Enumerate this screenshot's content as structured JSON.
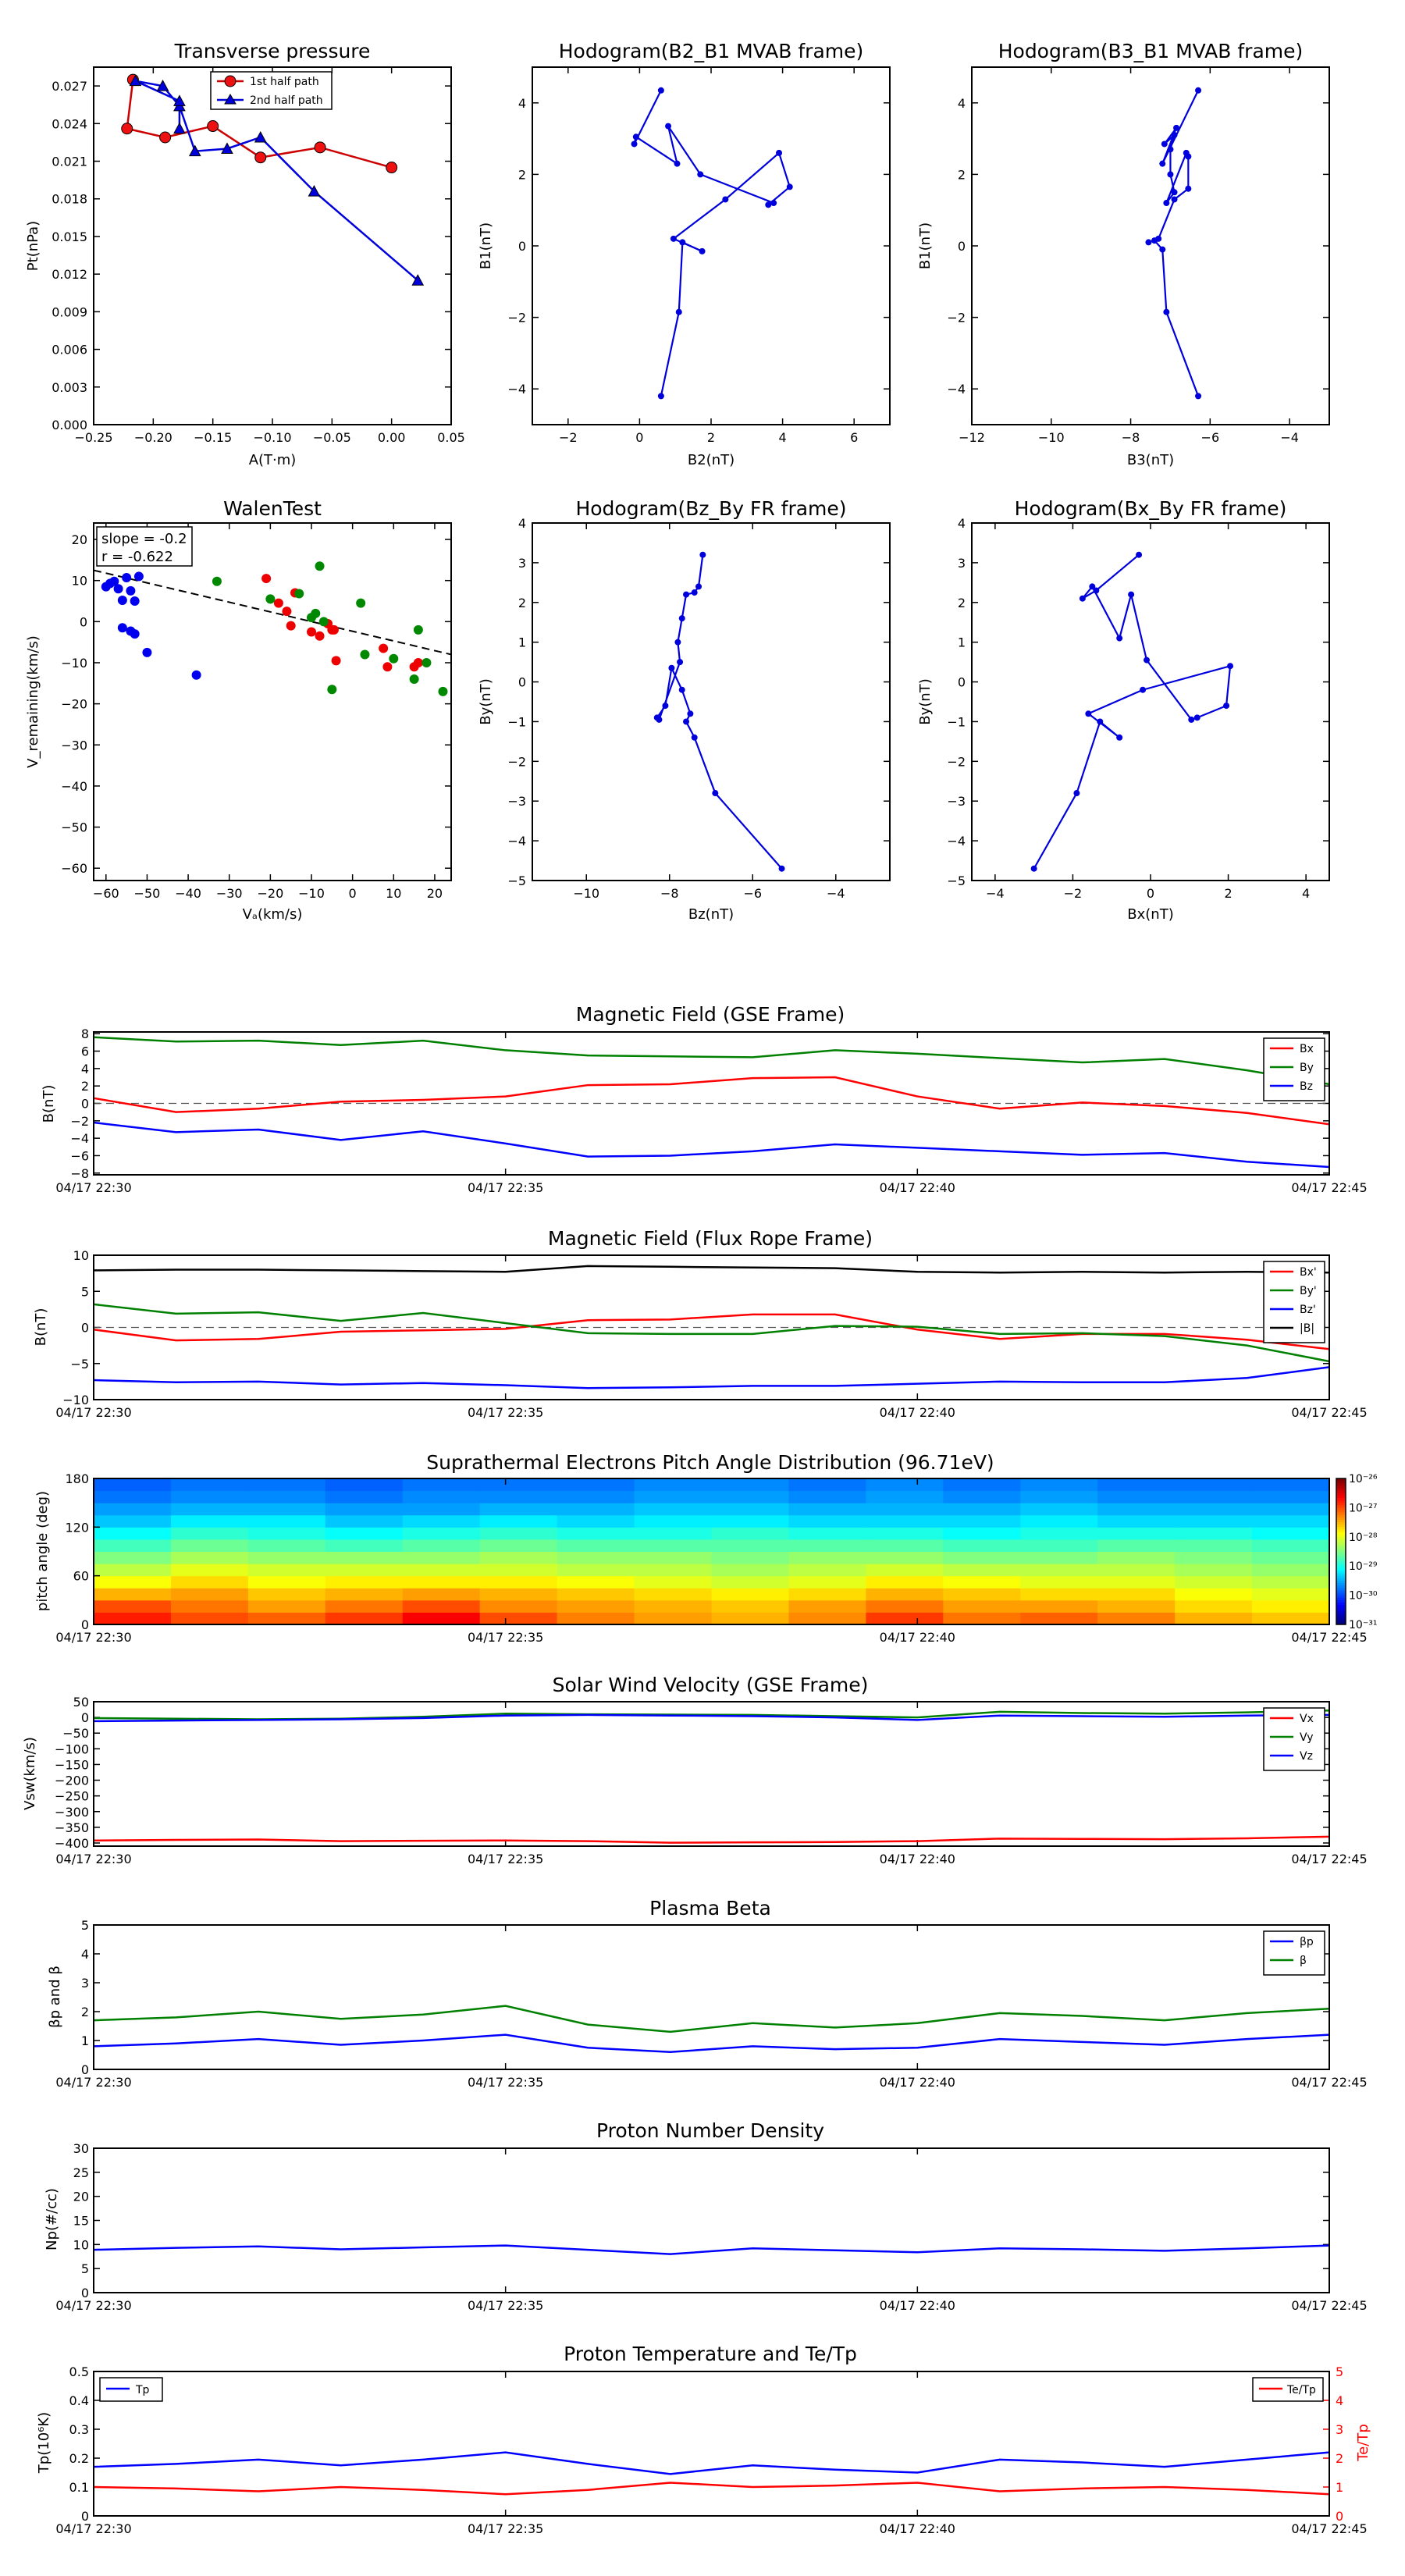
{
  "tp": {
    "title": "Transverse pressure",
    "xlabel": "A(T·m)",
    "ylabel": "Pt(nPa)",
    "xticks": [
      "−0.25",
      "−0.20",
      "−0.15",
      "−0.10",
      "−0.05",
      "0.00",
      "0.05"
    ],
    "yticks": [
      "0.000",
      "0.003",
      "0.006",
      "0.009",
      "0.012",
      "0.015",
      "0.018",
      "0.021",
      "0.024",
      "0.027"
    ],
    "legend": [
      "1st half path",
      "2nd half path"
    ],
    "xlim": [
      -0.25,
      0.05
    ],
    "ylim": [
      0.0,
      0.0285
    ],
    "s1": [
      [
        0.0,
        0.0205
      ],
      [
        -0.06,
        0.0221
      ],
      [
        -0.11,
        0.0213
      ],
      [
        -0.15,
        0.0238
      ],
      [
        -0.19,
        0.0229
      ],
      [
        -0.222,
        0.0236
      ],
      [
        -0.217,
        0.0275
      ]
    ],
    "s2": [
      [
        0.022,
        0.0115
      ],
      [
        -0.065,
        0.0186
      ],
      [
        -0.11,
        0.0229
      ],
      [
        -0.138,
        0.022
      ],
      [
        -0.165,
        0.0218
      ],
      [
        -0.178,
        0.0254
      ],
      [
        -0.192,
        0.027
      ],
      [
        -0.215,
        0.0274
      ],
      [
        -0.178,
        0.0258
      ],
      [
        -0.178,
        0.0236
      ]
    ]
  },
  "h1": {
    "title": "Hodogram(B2_B1 MVAB frame)",
    "xlabel": "B2(nT)",
    "ylabel": "B1(nT)",
    "xticks": [
      "−2",
      "0",
      "2",
      "4",
      "6"
    ],
    "yticks": [
      "−4",
      "−2",
      "0",
      "2",
      "4"
    ],
    "xlim": [
      -3,
      7
    ],
    "ylim": [
      -5,
      5
    ],
    "pts": [
      [
        0.6,
        -4.2
      ],
      [
        1.1,
        -1.85
      ],
      [
        1.2,
        0.1
      ],
      [
        1.75,
        -0.15
      ],
      [
        0.95,
        0.2
      ],
      [
        2.4,
        1.3
      ],
      [
        3.9,
        2.6
      ],
      [
        4.2,
        1.65
      ],
      [
        3.6,
        1.15
      ],
      [
        3.75,
        1.2
      ],
      [
        1.7,
        2.0
      ],
      [
        0.8,
        3.35
      ],
      [
        1.05,
        2.3
      ],
      [
        -0.1,
        3.05
      ],
      [
        -0.15,
        2.85
      ],
      [
        0.6,
        4.35
      ]
    ]
  },
  "h2": {
    "title": "Hodogram(B3_B1 MVAB frame)",
    "xlabel": "B3(nT)",
    "ylabel": "B1(nT)",
    "xticks": [
      "−12",
      "−10",
      "−8",
      "−6",
      "−4"
    ],
    "yticks": [
      "−4",
      "−2",
      "0",
      "2",
      "4"
    ],
    "xlim": [
      -12,
      -3
    ],
    "ylim": [
      -5,
      5
    ],
    "pts": [
      [
        -6.3,
        -4.2
      ],
      [
        -7.1,
        -1.85
      ],
      [
        -7.2,
        -0.1
      ],
      [
        -7.4,
        0.15
      ],
      [
        -7.55,
        0.1
      ],
      [
        -7.3,
        0.2
      ],
      [
        -6.9,
        1.3
      ],
      [
        -6.55,
        1.6
      ],
      [
        -6.55,
        2.5
      ],
      [
        -6.6,
        2.6
      ],
      [
        -7.1,
        1.2
      ],
      [
        -6.9,
        1.5
      ],
      [
        -7.0,
        2.0
      ],
      [
        -7.0,
        2.7
      ],
      [
        -6.9,
        3.1
      ],
      [
        -7.15,
        2.85
      ],
      [
        -6.85,
        3.3
      ],
      [
        -7.2,
        2.3
      ],
      [
        -6.3,
        4.35
      ]
    ]
  },
  "wt": {
    "title": "WalenTest",
    "xlabel": "Vₐ(km/s)",
    "ylabel": "V_remaining(km/s)",
    "xticks": [
      "−60",
      "−50",
      "−40",
      "−30",
      "−20",
      "−10",
      "0",
      "10",
      "20"
    ],
    "yticks": [
      "−60",
      "−50",
      "−40",
      "−30",
      "−20",
      "−10",
      "0",
      "10",
      "20"
    ],
    "slope_text": "slope = -0.2",
    "r_text": "r = -0.622",
    "xlim": [
      -63,
      24
    ],
    "ylim": [
      -63,
      24
    ],
    "line": [
      [
        -63,
        12.5
      ],
      [
        24,
        -8
      ]
    ],
    "blue": [
      [
        -60,
        8.5
      ],
      [
        -59,
        9.3
      ],
      [
        -58,
        9.8
      ],
      [
        -57,
        8
      ],
      [
        -56,
        5.2
      ],
      [
        -55,
        10.7
      ],
      [
        -54,
        7.5
      ],
      [
        -53,
        5
      ],
      [
        -52,
        11
      ],
      [
        -56,
        -1.5
      ],
      [
        -54,
        -2.3
      ],
      [
        -53,
        -3
      ],
      [
        -50,
        -7.5
      ],
      [
        -38,
        -13
      ]
    ],
    "red": [
      [
        -21,
        10.5
      ],
      [
        -18,
        4.5
      ],
      [
        -16,
        2.5
      ],
      [
        -14,
        7
      ],
      [
        -15,
        -1
      ],
      [
        -10,
        -2.5
      ],
      [
        -8,
        -3.5
      ],
      [
        -6,
        -0.5
      ],
      [
        -5,
        -2
      ],
      [
        -4.5,
        -2
      ],
      [
        -4,
        -9.5
      ],
      [
        7.5,
        -6.5
      ],
      [
        8.5,
        -11
      ],
      [
        15,
        -11
      ],
      [
        16,
        -10
      ]
    ],
    "green": [
      [
        -33,
        9.8
      ],
      [
        -20,
        5.5
      ],
      [
        -13,
        6.8
      ],
      [
        -10,
        1
      ],
      [
        -9,
        2
      ],
      [
        -8,
        13.5
      ],
      [
        -7,
        0
      ],
      [
        -5,
        -16.5
      ],
      [
        2,
        4.5
      ],
      [
        3,
        -8
      ],
      [
        10,
        -9
      ],
      [
        15,
        -14
      ],
      [
        16,
        -2
      ],
      [
        18,
        -10
      ],
      [
        22,
        -17
      ]
    ]
  },
  "h3": {
    "title": "Hodogram(Bz_By FR frame)",
    "xlabel": "Bz(nT)",
    "ylabel": "By(nT)",
    "xticks": [
      "−10",
      "−8",
      "−6",
      "−4"
    ],
    "yticks": [
      "−5",
      "−4",
      "−3",
      "−2",
      "−1",
      "0",
      "1",
      "2",
      "3",
      "4"
    ],
    "xlim": [
      -11.3,
      -2.7
    ],
    "ylim": [
      -5,
      4
    ],
    "pts": [
      [
        -5.3,
        -4.7
      ],
      [
        -6.9,
        -2.8
      ],
      [
        -7.4,
        -1.4
      ],
      [
        -7.6,
        -1.0
      ],
      [
        -7.5,
        -0.8
      ],
      [
        -7.7,
        -0.2
      ],
      [
        -7.95,
        0.35
      ],
      [
        -8.1,
        -0.6
      ],
      [
        -8.3,
        -0.9
      ],
      [
        -8.25,
        -0.95
      ],
      [
        -7.75,
        0.5
      ],
      [
        -7.8,
        1.0
      ],
      [
        -7.7,
        1.6
      ],
      [
        -7.6,
        2.2
      ],
      [
        -7.4,
        2.25
      ],
      [
        -7.3,
        2.4
      ],
      [
        -7.2,
        3.2
      ]
    ]
  },
  "h4": {
    "title": "Hodogram(Bx_By FR frame)",
    "xlabel": "Bx(nT)",
    "ylabel": "By(nT)",
    "xticks": [
      "−4",
      "−2",
      "0",
      "2",
      "4"
    ],
    "yticks": [
      "−5",
      "−4",
      "−3",
      "−2",
      "−1",
      "0",
      "1",
      "2",
      "3",
      "4"
    ],
    "xlim": [
      -4.6,
      4.6
    ],
    "ylim": [
      -5,
      4
    ],
    "pts": [
      [
        -3.0,
        -4.7
      ],
      [
        -1.9,
        -2.8
      ],
      [
        -1.3,
        -1.0
      ],
      [
        -0.8,
        -1.4
      ],
      [
        -1.6,
        -0.8
      ],
      [
        -0.2,
        -0.2
      ],
      [
        2.05,
        0.4
      ],
      [
        1.95,
        -0.6
      ],
      [
        1.2,
        -0.9
      ],
      [
        1.05,
        -0.95
      ],
      [
        -0.1,
        0.55
      ],
      [
        -0.5,
        2.2
      ],
      [
        -0.8,
        1.1
      ],
      [
        -1.5,
        2.4
      ],
      [
        -1.75,
        2.1
      ],
      [
        -1.4,
        2.3
      ],
      [
        -0.3,
        3.2
      ]
    ]
  },
  "ts": {
    "xticks": [
      "04/17 22:30",
      "04/17 22:35",
      "04/17 22:40",
      "04/17 22:45"
    ],
    "t": [
      0,
      1,
      2,
      3,
      4,
      5,
      6,
      7,
      8,
      9,
      10,
      11,
      12,
      13,
      14,
      15
    ]
  },
  "mf": {
    "title": "Magnetic Field (GSE Frame)",
    "ylabel": "B(nT)",
    "yticks": [
      "−8",
      "−6",
      "−4",
      "−2",
      "0",
      "2",
      "4",
      "6",
      "8"
    ],
    "ylim": [
      -8.2,
      8.2
    ],
    "series": [
      {
        "name": "Bx",
        "color": "#ff0000",
        "values": [
          0.6,
          -1.0,
          -0.6,
          0.2,
          0.4,
          0.8,
          2.1,
          2.2,
          2.9,
          3.0,
          0.8,
          -0.6,
          0.1,
          -0.3,
          -1.1,
          -2.4
        ]
      },
      {
        "name": "By",
        "color": "#008000",
        "values": [
          7.6,
          7.1,
          7.2,
          6.7,
          7.2,
          6.1,
          5.5,
          5.4,
          5.3,
          6.1,
          5.7,
          5.2,
          4.7,
          5.1,
          3.8,
          2.2
        ]
      },
      {
        "name": "Bz",
        "color": "#0000ff",
        "values": [
          -2.2,
          -3.3,
          -3.0,
          -4.2,
          -3.2,
          -4.6,
          -6.1,
          -6.0,
          -5.5,
          -4.7,
          -5.1,
          -5.5,
          -5.9,
          -5.7,
          -6.7,
          -7.3
        ]
      }
    ]
  },
  "fr": {
    "title": "Magnetic Field (Flux Rope Frame)",
    "ylabel": "B(nT)",
    "yticks": [
      "−10",
      "−5",
      "0",
      "5",
      "10"
    ],
    "ylim": [
      -10,
      10
    ],
    "series": [
      {
        "name": "Bx'",
        "color": "#ff0000",
        "values": [
          -0.3,
          -1.8,
          -1.6,
          -0.6,
          -0.4,
          -0.2,
          1.0,
          1.1,
          1.8,
          1.8,
          -0.3,
          -1.6,
          -0.9,
          -0.9,
          -1.7,
          -3.0
        ]
      },
      {
        "name": "By'",
        "color": "#008000",
        "values": [
          3.2,
          1.9,
          2.1,
          0.9,
          2.0,
          0.6,
          -0.8,
          -0.9,
          -0.9,
          0.2,
          0.1,
          -0.9,
          -0.8,
          -1.2,
          -2.5,
          -4.7
        ]
      },
      {
        "name": "Bz'",
        "color": "#0000ff",
        "values": [
          -7.3,
          -7.6,
          -7.5,
          -7.9,
          -7.7,
          -8.0,
          -8.4,
          -8.3,
          -8.1,
          -8.1,
          -7.8,
          -7.5,
          -7.6,
          -7.6,
          -7.0,
          -5.5
        ]
      },
      {
        "name": "|B|",
        "color": "#000000",
        "values": [
          7.9,
          8.0,
          8.0,
          7.9,
          7.8,
          7.7,
          8.5,
          8.4,
          8.3,
          8.2,
          7.7,
          7.6,
          7.7,
          7.6,
          7.7,
          7.6
        ]
      }
    ]
  },
  "pad": {
    "title": "Suprathermal Electrons Pitch Angle Distribution (96.71eV)",
    "ylabel": "pitch angle (deg)",
    "yticks": [
      "0",
      "60",
      "120",
      "180"
    ],
    "cbar": [
      "10⁻²⁶",
      "10⁻²⁷",
      "10⁻²⁸",
      "10⁻²⁹",
      "10⁻³⁰",
      "10⁻³¹"
    ],
    "matrix": [
      [
        0.85,
        0.8,
        0.78,
        0.82,
        0.88,
        0.8,
        0.75,
        0.72,
        0.7,
        0.74,
        0.82,
        0.76,
        0.78,
        0.75,
        0.7,
        0.68
      ],
      [
        0.8,
        0.76,
        0.72,
        0.76,
        0.8,
        0.74,
        0.72,
        0.7,
        0.68,
        0.72,
        0.76,
        0.72,
        0.72,
        0.7,
        0.66,
        0.64
      ],
      [
        0.7,
        0.72,
        0.68,
        0.7,
        0.72,
        0.7,
        0.68,
        0.66,
        0.64,
        0.66,
        0.7,
        0.68,
        0.66,
        0.66,
        0.62,
        0.6
      ],
      [
        0.62,
        0.66,
        0.62,
        0.64,
        0.64,
        0.64,
        0.62,
        0.6,
        0.58,
        0.6,
        0.64,
        0.62,
        0.6,
        0.6,
        0.58,
        0.56
      ],
      [
        0.56,
        0.6,
        0.58,
        0.58,
        0.58,
        0.58,
        0.56,
        0.56,
        0.54,
        0.56,
        0.58,
        0.56,
        0.56,
        0.56,
        0.54,
        0.52
      ],
      [
        0.5,
        0.54,
        0.52,
        0.52,
        0.52,
        0.54,
        0.52,
        0.52,
        0.5,
        0.52,
        0.52,
        0.5,
        0.5,
        0.52,
        0.5,
        0.48
      ],
      [
        0.44,
        0.48,
        0.46,
        0.44,
        0.46,
        0.48,
        0.46,
        0.46,
        0.46,
        0.46,
        0.46,
        0.44,
        0.44,
        0.46,
        0.46,
        0.44
      ],
      [
        0.38,
        0.42,
        0.4,
        0.38,
        0.4,
        0.42,
        0.4,
        0.4,
        0.42,
        0.4,
        0.4,
        0.38,
        0.4,
        0.4,
        0.4,
        0.38
      ],
      [
        0.32,
        0.36,
        0.36,
        0.32,
        0.34,
        0.36,
        0.34,
        0.36,
        0.36,
        0.34,
        0.34,
        0.34,
        0.36,
        0.34,
        0.34,
        0.34
      ],
      [
        0.28,
        0.3,
        0.3,
        0.28,
        0.28,
        0.3,
        0.3,
        0.32,
        0.32,
        0.3,
        0.3,
        0.3,
        0.32,
        0.3,
        0.3,
        0.3
      ],
      [
        0.24,
        0.26,
        0.26,
        0.24,
        0.26,
        0.26,
        0.26,
        0.28,
        0.28,
        0.26,
        0.28,
        0.26,
        0.28,
        0.26,
        0.26,
        0.26
      ],
      [
        0.22,
        0.24,
        0.24,
        0.22,
        0.24,
        0.24,
        0.24,
        0.26,
        0.26,
        0.24,
        0.26,
        0.24,
        0.26,
        0.24,
        0.24,
        0.24
      ]
    ]
  },
  "sw": {
    "title": "Solar Wind Velocity (GSE Frame)",
    "ylabel": "Vsw(km/s)",
    "yticks": [
      "−400",
      "−350",
      "−300",
      "−250",
      "−200",
      "−150",
      "−100",
      "−50",
      "0",
      "50"
    ],
    "ylim": [
      -410,
      50
    ],
    "series": [
      {
        "name": "Vx",
        "color": "#ff0000",
        "values": [
          -392,
          -390,
          -389,
          -394,
          -393,
          -392,
          -394,
          -399,
          -398,
          -397,
          -394,
          -386,
          -387,
          -388,
          -385,
          -380
        ]
      },
      {
        "name": "Vy",
        "color": "#008000",
        "values": [
          -2,
          -4,
          -6,
          -4,
          2,
          12,
          10,
          9,
          8,
          4,
          0,
          18,
          14,
          12,
          16,
          22
        ]
      },
      {
        "name": "Vz",
        "color": "#0000ff",
        "values": [
          -12,
          -10,
          -8,
          -6,
          -2,
          6,
          8,
          6,
          4,
          0,
          -8,
          6,
          4,
          2,
          6,
          8
        ]
      }
    ]
  },
  "pb": {
    "title": "Plasma Beta",
    "ylabel": "βp and β",
    "yticks": [
      "0",
      "1",
      "2",
      "3",
      "4",
      "5"
    ],
    "ylim": [
      0,
      5
    ],
    "series": [
      {
        "name": "βp",
        "color": "#0000ff",
        "values": [
          0.8,
          0.9,
          1.05,
          0.85,
          1.0,
          1.2,
          0.75,
          0.6,
          0.8,
          0.7,
          0.75,
          1.05,
          0.95,
          0.85,
          1.05,
          1.2
        ]
      },
      {
        "name": "β",
        "color": "#008000",
        "values": [
          1.7,
          1.8,
          2.0,
          1.75,
          1.9,
          2.2,
          1.55,
          1.3,
          1.6,
          1.45,
          1.6,
          1.95,
          1.85,
          1.7,
          1.95,
          2.1
        ]
      }
    ]
  },
  "np": {
    "title": "Proton Number Density",
    "ylabel": "Np(#/cc)",
    "yticks": [
      "0",
      "5",
      "10",
      "15",
      "20",
      "25",
      "30"
    ],
    "ylim": [
      0,
      30
    ],
    "series": [
      {
        "name": "Np",
        "color": "#0000ff",
        "values": [
          8.9,
          9.3,
          9.6,
          9.0,
          9.4,
          9.8,
          8.9,
          8.0,
          9.2,
          8.8,
          8.4,
          9.2,
          9.0,
          8.7,
          9.2,
          9.8
        ]
      }
    ]
  },
  "pt": {
    "title": "Proton Temperature and Te/Tp",
    "ylabel": "Tp(10⁶K)",
    "ylabel2": "Te/Tp",
    "yticks": [
      "0",
      "0.1",
      "0.2",
      "0.3",
      "0.4",
      "0.5"
    ],
    "ylim": [
      0,
      0.5
    ],
    "yticks2": [
      "0",
      "1",
      "2",
      "3",
      "4",
      "5"
    ],
    "ylim2": [
      0,
      5
    ],
    "legend_left": "Tp",
    "legend_right": "Te/Tp",
    "tp": {
      "name": "Tp",
      "color": "#0000ff",
      "values": [
        0.17,
        0.18,
        0.195,
        0.175,
        0.195,
        0.22,
        0.18,
        0.145,
        0.175,
        0.16,
        0.15,
        0.195,
        0.185,
        0.17,
        0.195,
        0.22
      ]
    },
    "ratio": {
      "name": "Te/Tp",
      "color": "#ff0000",
      "values": [
        1.0,
        0.95,
        0.85,
        1.0,
        0.9,
        0.75,
        0.9,
        1.15,
        1.0,
        1.05,
        1.15,
        0.85,
        0.95,
        1.0,
        0.9,
        0.75
      ]
    }
  }
}
